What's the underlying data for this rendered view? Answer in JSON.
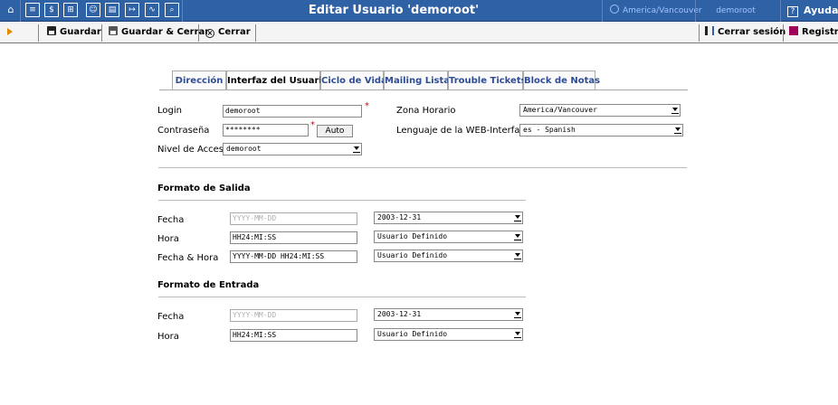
{
  "topbar": {
    "title": "Editar Usuario 'demoroot'",
    "timezone": "America/Vancouver",
    "user": "demoroot",
    "help": "Ayuda",
    "help_icon": "?",
    "icons": [
      "home-icon",
      "list-icon",
      "dollar-icon",
      "grid-icon",
      "person-icon",
      "table-icon",
      "export-icon",
      "chart-icon",
      "search-icon"
    ]
  },
  "toolbar": {
    "save": "Guardar",
    "save_close": "Guardar & Cerrar",
    "close": "Cerrar",
    "logout": "Cerrar sesión",
    "log": "Registro"
  },
  "tabs": [
    "Dirección",
    "Interfaz del Usuario",
    "Ciclo de Vida",
    "Mailing Lista",
    "Trouble Tickets",
    "Block de Notas"
  ],
  "active_tab": "Interfaz del Usuario",
  "form": {
    "login_label": "Login",
    "login_value": "demoroot",
    "password_label": "Contraseña",
    "password_value": "********",
    "auto_button": "Auto",
    "access_label": "Nivel de Acceso",
    "access_value": "demoroot",
    "timezone_label": "Zona Horario",
    "timezone_value": "America/Vancouver",
    "language_label": "Lenguaje de la WEB-Interface",
    "language_value": "es - Spanish",
    "required_mark": "*"
  },
  "output_format": {
    "heading": "Formato de Salida",
    "date_label": "Fecha",
    "date_placeholder": "YYYY-MM-DD",
    "date_select": "2003-12-31",
    "time_label": "Hora",
    "time_value": "HH24:MI:SS",
    "time_select": "Usuario Definido",
    "datetime_label": "Fecha & Hora",
    "datetime_value": "YYYY-MM-DD HH24:MI:SS",
    "datetime_select": "Usuario Definido"
  },
  "input_format": {
    "heading": "Formato de Entrada",
    "date_label": "Fecha",
    "date_placeholder": "YYYY-MM-DD",
    "date_select": "2003-12-31",
    "time_label": "Hora",
    "time_value": "HH24:MI:SS",
    "time_select": "Usuario Definido"
  },
  "colors": {
    "topbar": "#2f61a5",
    "tab_link": "#2f4d96",
    "required": "#dd0000"
  }
}
